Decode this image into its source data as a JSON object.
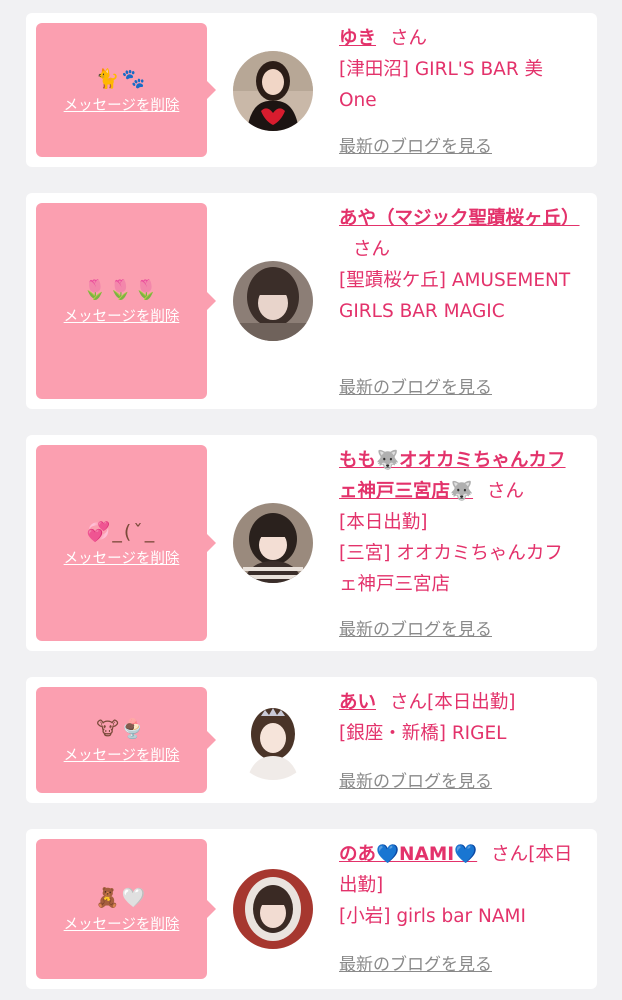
{
  "common": {
    "delete_label": "メッセージを削除",
    "blog_label": "最新のブログを見る",
    "honorific": "さん"
  },
  "colors": {
    "accent": "#e3326b",
    "bubble": "#fb9fb0",
    "muted_link": "#8a8a8a",
    "background": "#f1f1f3"
  },
  "messages": [
    {
      "emoji": "🐈🐾",
      "name": "ゆき",
      "status": "",
      "shop": "[津田沼] GIRL'S BAR 美One"
    },
    {
      "emoji": "🌷🌷🌷",
      "name": "あや（マジック聖蹟桜ヶ丘）",
      "status": "",
      "shop": "[聖蹟桜ケ丘] AMUSEMENT GIRLS BAR MAGIC"
    },
    {
      "emoji": "💞_(ˇ_",
      "name": "もも🐺オオカミちゃんカフェ神戸三宮店🐺",
      "status": "[本日出勤]",
      "shop": "[三宮] オオカミちゃんカフェ神戸三宮店"
    },
    {
      "emoji": "🐮🍨",
      "name": "あい",
      "status": "[本日出勤]",
      "shop": "[銀座・新橋] RIGEL"
    },
    {
      "emoji": "🧸🤍",
      "name": "のあ💙NAMI💙",
      "status": "[本日出勤]",
      "shop": "[小岩] girls bar NAMI"
    }
  ]
}
